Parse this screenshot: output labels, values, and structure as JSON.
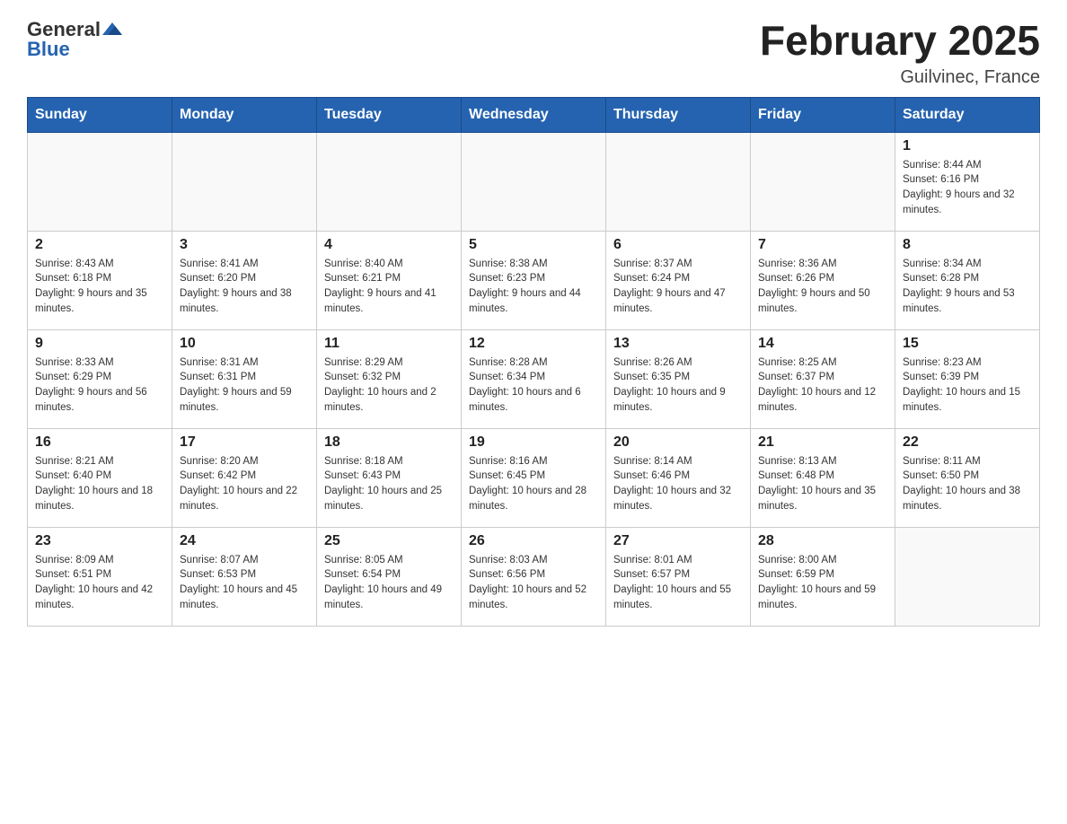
{
  "header": {
    "logo_general": "General",
    "logo_blue": "Blue",
    "month_year": "February 2025",
    "location": "Guilvinec, France"
  },
  "days_of_week": [
    "Sunday",
    "Monday",
    "Tuesday",
    "Wednesday",
    "Thursday",
    "Friday",
    "Saturday"
  ],
  "weeks": [
    [
      {
        "day": "",
        "info": ""
      },
      {
        "day": "",
        "info": ""
      },
      {
        "day": "",
        "info": ""
      },
      {
        "day": "",
        "info": ""
      },
      {
        "day": "",
        "info": ""
      },
      {
        "day": "",
        "info": ""
      },
      {
        "day": "1",
        "info": "Sunrise: 8:44 AM\nSunset: 6:16 PM\nDaylight: 9 hours and 32 minutes."
      }
    ],
    [
      {
        "day": "2",
        "info": "Sunrise: 8:43 AM\nSunset: 6:18 PM\nDaylight: 9 hours and 35 minutes."
      },
      {
        "day": "3",
        "info": "Sunrise: 8:41 AM\nSunset: 6:20 PM\nDaylight: 9 hours and 38 minutes."
      },
      {
        "day": "4",
        "info": "Sunrise: 8:40 AM\nSunset: 6:21 PM\nDaylight: 9 hours and 41 minutes."
      },
      {
        "day": "5",
        "info": "Sunrise: 8:38 AM\nSunset: 6:23 PM\nDaylight: 9 hours and 44 minutes."
      },
      {
        "day": "6",
        "info": "Sunrise: 8:37 AM\nSunset: 6:24 PM\nDaylight: 9 hours and 47 minutes."
      },
      {
        "day": "7",
        "info": "Sunrise: 8:36 AM\nSunset: 6:26 PM\nDaylight: 9 hours and 50 minutes."
      },
      {
        "day": "8",
        "info": "Sunrise: 8:34 AM\nSunset: 6:28 PM\nDaylight: 9 hours and 53 minutes."
      }
    ],
    [
      {
        "day": "9",
        "info": "Sunrise: 8:33 AM\nSunset: 6:29 PM\nDaylight: 9 hours and 56 minutes."
      },
      {
        "day": "10",
        "info": "Sunrise: 8:31 AM\nSunset: 6:31 PM\nDaylight: 9 hours and 59 minutes."
      },
      {
        "day": "11",
        "info": "Sunrise: 8:29 AM\nSunset: 6:32 PM\nDaylight: 10 hours and 2 minutes."
      },
      {
        "day": "12",
        "info": "Sunrise: 8:28 AM\nSunset: 6:34 PM\nDaylight: 10 hours and 6 minutes."
      },
      {
        "day": "13",
        "info": "Sunrise: 8:26 AM\nSunset: 6:35 PM\nDaylight: 10 hours and 9 minutes."
      },
      {
        "day": "14",
        "info": "Sunrise: 8:25 AM\nSunset: 6:37 PM\nDaylight: 10 hours and 12 minutes."
      },
      {
        "day": "15",
        "info": "Sunrise: 8:23 AM\nSunset: 6:39 PM\nDaylight: 10 hours and 15 minutes."
      }
    ],
    [
      {
        "day": "16",
        "info": "Sunrise: 8:21 AM\nSunset: 6:40 PM\nDaylight: 10 hours and 18 minutes."
      },
      {
        "day": "17",
        "info": "Sunrise: 8:20 AM\nSunset: 6:42 PM\nDaylight: 10 hours and 22 minutes."
      },
      {
        "day": "18",
        "info": "Sunrise: 8:18 AM\nSunset: 6:43 PM\nDaylight: 10 hours and 25 minutes."
      },
      {
        "day": "19",
        "info": "Sunrise: 8:16 AM\nSunset: 6:45 PM\nDaylight: 10 hours and 28 minutes."
      },
      {
        "day": "20",
        "info": "Sunrise: 8:14 AM\nSunset: 6:46 PM\nDaylight: 10 hours and 32 minutes."
      },
      {
        "day": "21",
        "info": "Sunrise: 8:13 AM\nSunset: 6:48 PM\nDaylight: 10 hours and 35 minutes."
      },
      {
        "day": "22",
        "info": "Sunrise: 8:11 AM\nSunset: 6:50 PM\nDaylight: 10 hours and 38 minutes."
      }
    ],
    [
      {
        "day": "23",
        "info": "Sunrise: 8:09 AM\nSunset: 6:51 PM\nDaylight: 10 hours and 42 minutes."
      },
      {
        "day": "24",
        "info": "Sunrise: 8:07 AM\nSunset: 6:53 PM\nDaylight: 10 hours and 45 minutes."
      },
      {
        "day": "25",
        "info": "Sunrise: 8:05 AM\nSunset: 6:54 PM\nDaylight: 10 hours and 49 minutes."
      },
      {
        "day": "26",
        "info": "Sunrise: 8:03 AM\nSunset: 6:56 PM\nDaylight: 10 hours and 52 minutes."
      },
      {
        "day": "27",
        "info": "Sunrise: 8:01 AM\nSunset: 6:57 PM\nDaylight: 10 hours and 55 minutes."
      },
      {
        "day": "28",
        "info": "Sunrise: 8:00 AM\nSunset: 6:59 PM\nDaylight: 10 hours and 59 minutes."
      },
      {
        "day": "",
        "info": ""
      }
    ]
  ]
}
